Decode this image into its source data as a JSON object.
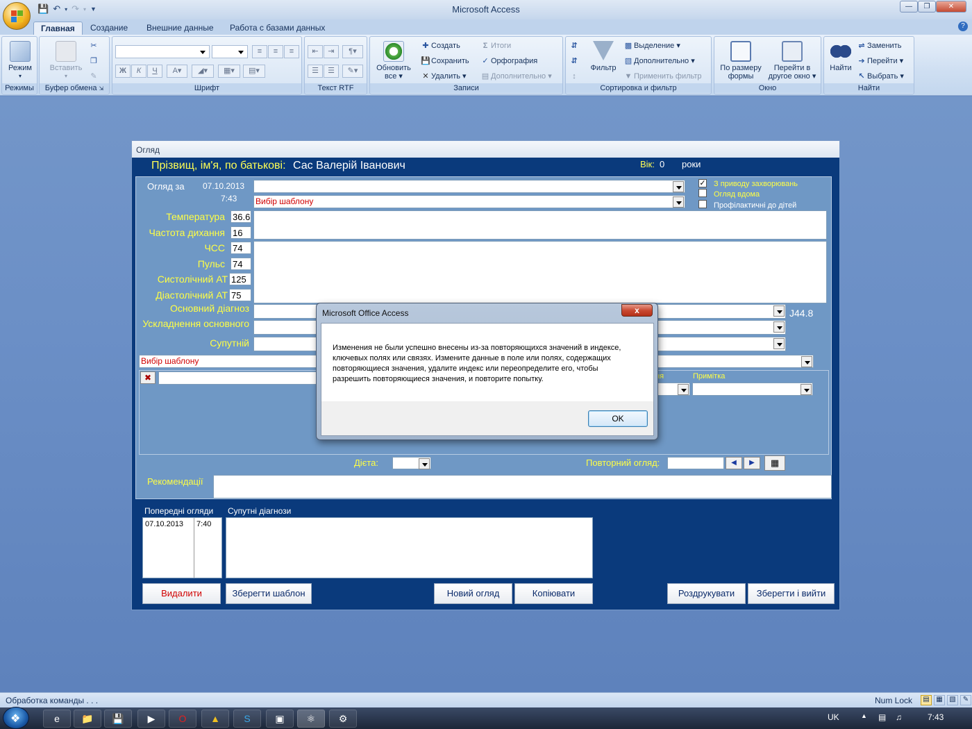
{
  "app": {
    "title": "Microsoft Access",
    "qat": [
      "save",
      "undo",
      "redo",
      "customize"
    ]
  },
  "ribbon": {
    "tabs": [
      "Главная",
      "Создание",
      "Внешние данные",
      "Работа с базами данных"
    ],
    "active_tab": "Главная",
    "groups": {
      "views": {
        "label": "Режимы",
        "mode_btn": "Режим"
      },
      "clipboard": {
        "label": "Буфер обмена",
        "paste": "Вставить"
      },
      "font": {
        "label": "Шрифт"
      },
      "rtf": {
        "label": "Текст RTF"
      },
      "records": {
        "label": "Записи",
        "refresh": "Обновить все",
        "create": "Создать",
        "save": "Сохранить",
        "delete": "Удалить",
        "totals": "Итоги",
        "spelling": "Орфография",
        "more": "Дополнительно"
      },
      "sort": {
        "label": "Сортировка и фильтр",
        "filter": "Фильтр",
        "selection": "Выделение",
        "advanced": "Дополнительно",
        "toggle": "Применить фильтр"
      },
      "window": {
        "label": "Окно",
        "fit": "По размеру формы",
        "switch": "Перейти в другое окно"
      },
      "find": {
        "label": "Найти",
        "find": "Найти",
        "replace": "Заменить",
        "goto": "Перейти",
        "select": "Выбрать"
      }
    }
  },
  "form": {
    "caption": "Огляд",
    "header": {
      "patient_label": "Прізвищ, ім'я, по батькові:",
      "patient_name": "Сас Валерій Іванович",
      "age_label": "Вік:",
      "age_value": "0",
      "age_unit": "роки"
    },
    "exam": {
      "date_label": "Огляд за",
      "date": "07.10.2013",
      "time": "7:43",
      "template_placeholder": "Вибір шаблону",
      "checks": [
        {
          "label": "З приводу захворювань",
          "checked": true
        },
        {
          "label": "Огляд вдома",
          "checked": false
        },
        {
          "label": "Профілактичні до дітей",
          "checked": false
        }
      ]
    },
    "vitals": [
      {
        "label": "Температура",
        "value": "36.6"
      },
      {
        "label": "Частота дихання",
        "value": "16"
      },
      {
        "label": "ЧСС",
        "value": "74"
      },
      {
        "label": "Пульс",
        "value": "74"
      },
      {
        "label": "Систолічний АТ",
        "value": "125"
      },
      {
        "label": "Діастолічний АТ",
        "value": "75"
      }
    ],
    "diagnosis": {
      "main_label": "Основний діагноз",
      "main_code": "J44.8",
      "complication_label": "Ускладнення основного",
      "accompanying_label": "Супутній"
    },
    "treatment": {
      "template_placeholder": "Вибір шаблону",
      "col_suffix": "ння",
      "note_label": "Примітка"
    },
    "diet_label": "Дієта:",
    "repeat_label": "Повторний огляд:",
    "recommendations_label": "Рекомендації",
    "prev_exams": {
      "label": "Попередні огляди",
      "rows": [
        {
          "date": "07.10.2013",
          "time": "7:40"
        }
      ]
    },
    "accompanying_diag_label": "Супутні діагнози",
    "buttons": {
      "delete": "Видалити",
      "save_template": "Зберегти шаблон",
      "new_exam": "Новий огляд",
      "copy": "Копіювати",
      "print": "Роздрукувати",
      "save_exit": "Зберегти і вийти"
    }
  },
  "dialog": {
    "title": "Microsoft Office Access",
    "message": "Изменения не были успешно внесены из-за повторяющихся значений в индексе, ключевых полях или связях.  Измените данные в поле или полях, содержащих повторяющиеся значения, удалите индекс или переопределите его, чтобы разрешить повторяющиеся значения, и повторите попытку.",
    "ok": "OK",
    "close": "x"
  },
  "status": {
    "left": "Обработка команды . . .",
    "numlock": "Num Lock"
  },
  "taskbar": {
    "lang": "UK",
    "clock": "7:43"
  }
}
